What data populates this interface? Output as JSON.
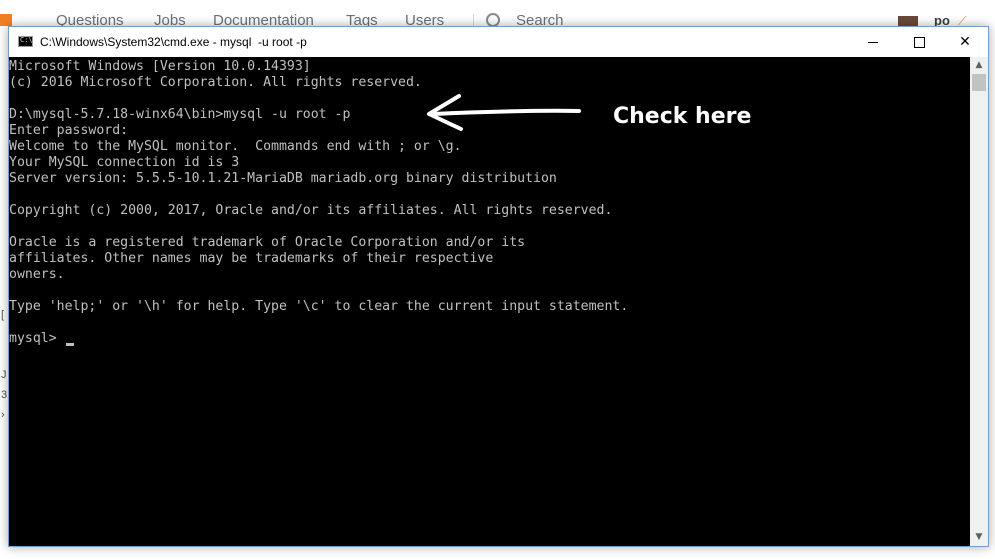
{
  "background_page": {
    "nav_items": [
      "Questions",
      "Jobs",
      "Documentation",
      "Tags",
      "Users"
    ],
    "search_placeholder": "Search",
    "user_label": "po",
    "left_marks": [
      "[",
      "J",
      "3",
      "›"
    ]
  },
  "window": {
    "title": "C:\\Windows\\System32\\cmd.exe - mysql  -u root -p",
    "icon_text": "C:\\",
    "controls": {
      "minimize": "—",
      "maximize": "☐",
      "close": "✕"
    }
  },
  "console": {
    "lines": [
      "Microsoft Windows [Version 10.0.14393]",
      "(c) 2016 Microsoft Corporation. All rights reserved.",
      "",
      "D:\\mysql-5.7.18-winx64\\bin>mysql -u root -p",
      "Enter password:",
      "Welcome to the MySQL monitor.  Commands end with ; or \\g.",
      "Your MySQL connection id is 3",
      "Server version: 5.5.5-10.1.21-MariaDB mariadb.org binary distribution",
      "",
      "Copyright (c) 2000, 2017, Oracle and/or its affiliates. All rights reserved.",
      "",
      "Oracle is a registered trademark of Oracle Corporation and/or its",
      "affiliates. Other names may be trademarks of their respective",
      "owners.",
      "",
      "Type 'help;' or '\\h' for help. Type '\\c' to clear the current input statement.",
      "",
      "mysql> "
    ],
    "annotation": "Check here"
  },
  "scrollbar": {
    "up_arrow": "▲",
    "down_arrow": "▼"
  },
  "colors": {
    "console_bg": "#000000",
    "console_text": "#c0c0c0",
    "annotation": "#ffffff"
  }
}
